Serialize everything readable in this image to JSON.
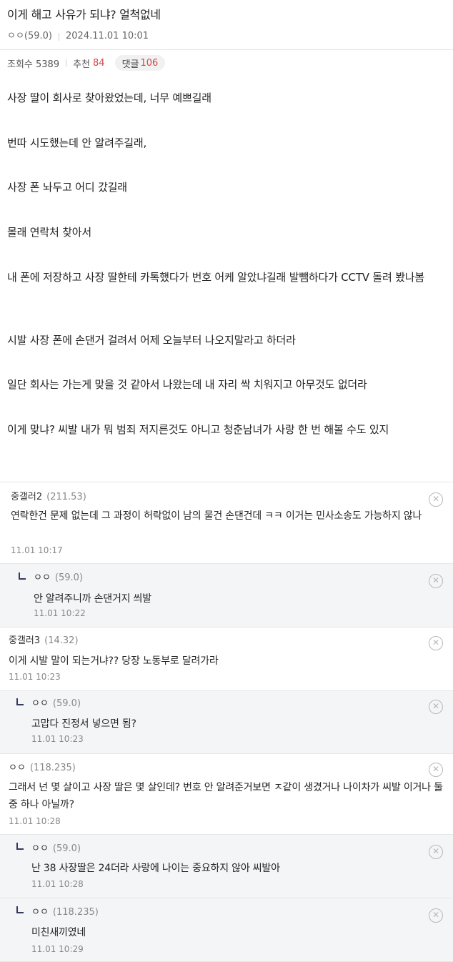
{
  "post": {
    "title": "이게 해고 사유가 되냐? 얼척없네",
    "author": "ㅇㅇ(59.0)",
    "date": "2024.11.01 10:01",
    "views_label": "조회수 5389",
    "recommend_label": "추천",
    "recommend_count": "84",
    "comments_label": "댓글",
    "comments_count": "106",
    "paragraphs": [
      "사장 딸이 회사로 찾아왔었는데, 너무 예쁘길래",
      "번따 시도했는데 안 알려주길래,",
      "사장 폰 놔두고 어디 갔길래",
      "몰래 연락처 찾아서",
      "내 폰에 저장하고 사장 딸한테 카톡했다가 번호 어케 알았냐길래 발뺌하다가 CCTV 돌려 봤나봄",
      "시발 사장 폰에 손댄거 걸려서 어제 오늘부터 나오지말라고 하더라",
      "일단 회사는 가는게 맞을 것 같아서 나왔는데 내 자리 싹 치워지고 아무것도 없더라",
      "이게 맞냐? 씨발 내가 뭐 범죄 저지른것도 아니고 청춘남녀가 사랑 한 번 해볼 수도 있지"
    ]
  },
  "comments": [
    {
      "name": "중갤러2",
      "ip": "(211.53)",
      "text": "연락한건 문제 없는데 그 과정이 허락없이 남의 물건 손댄건데 ㅋㅋ 이거는 민사소송도 가능하지 않나",
      "time": "11.01 10:17"
    },
    {
      "name": "ㅇㅇ",
      "ip": "(59.0)",
      "text": "안 알려주니까 손댄거지 씌발",
      "time": "11.01 10:22"
    },
    {
      "name": "중갤러3",
      "ip": "(14.32)",
      "text": "이게 시발 말이 되는거냐?? 당장 노동부로 달려가라",
      "time": "11.01 10:23"
    },
    {
      "name": "ㅇㅇ",
      "ip": "(59.0)",
      "text": "고맙다 진정서 넣으면 됨?",
      "time": "11.01 10:23"
    },
    {
      "name": "ㅇㅇ",
      "ip": "(118.235)",
      "text": "그래서 넌 몇 살이고 사장 딸은 몇 살인데? 번호 안 알려준거보면 ㅈ같이 생겼거나 나이차가 씨발 이거나 둘 중 하나 아닐까?",
      "time": "11.01 10:28"
    },
    {
      "name": "ㅇㅇ",
      "ip": "(59.0)",
      "text": "난 38 사장딸은 24더라 사랑에 나이는 중요하지 않아 씨발아",
      "time": "11.01 10:28"
    },
    {
      "name": "ㅇㅇ",
      "ip": "(118.235)",
      "text": "미친새끼였네",
      "time": "11.01 10:29"
    }
  ],
  "icons": {
    "close": "close-circle-icon",
    "reply": "reply-arrow-icon"
  },
  "colors": {
    "accent": "#d64545",
    "reply_bg": "#f4f5f7"
  }
}
